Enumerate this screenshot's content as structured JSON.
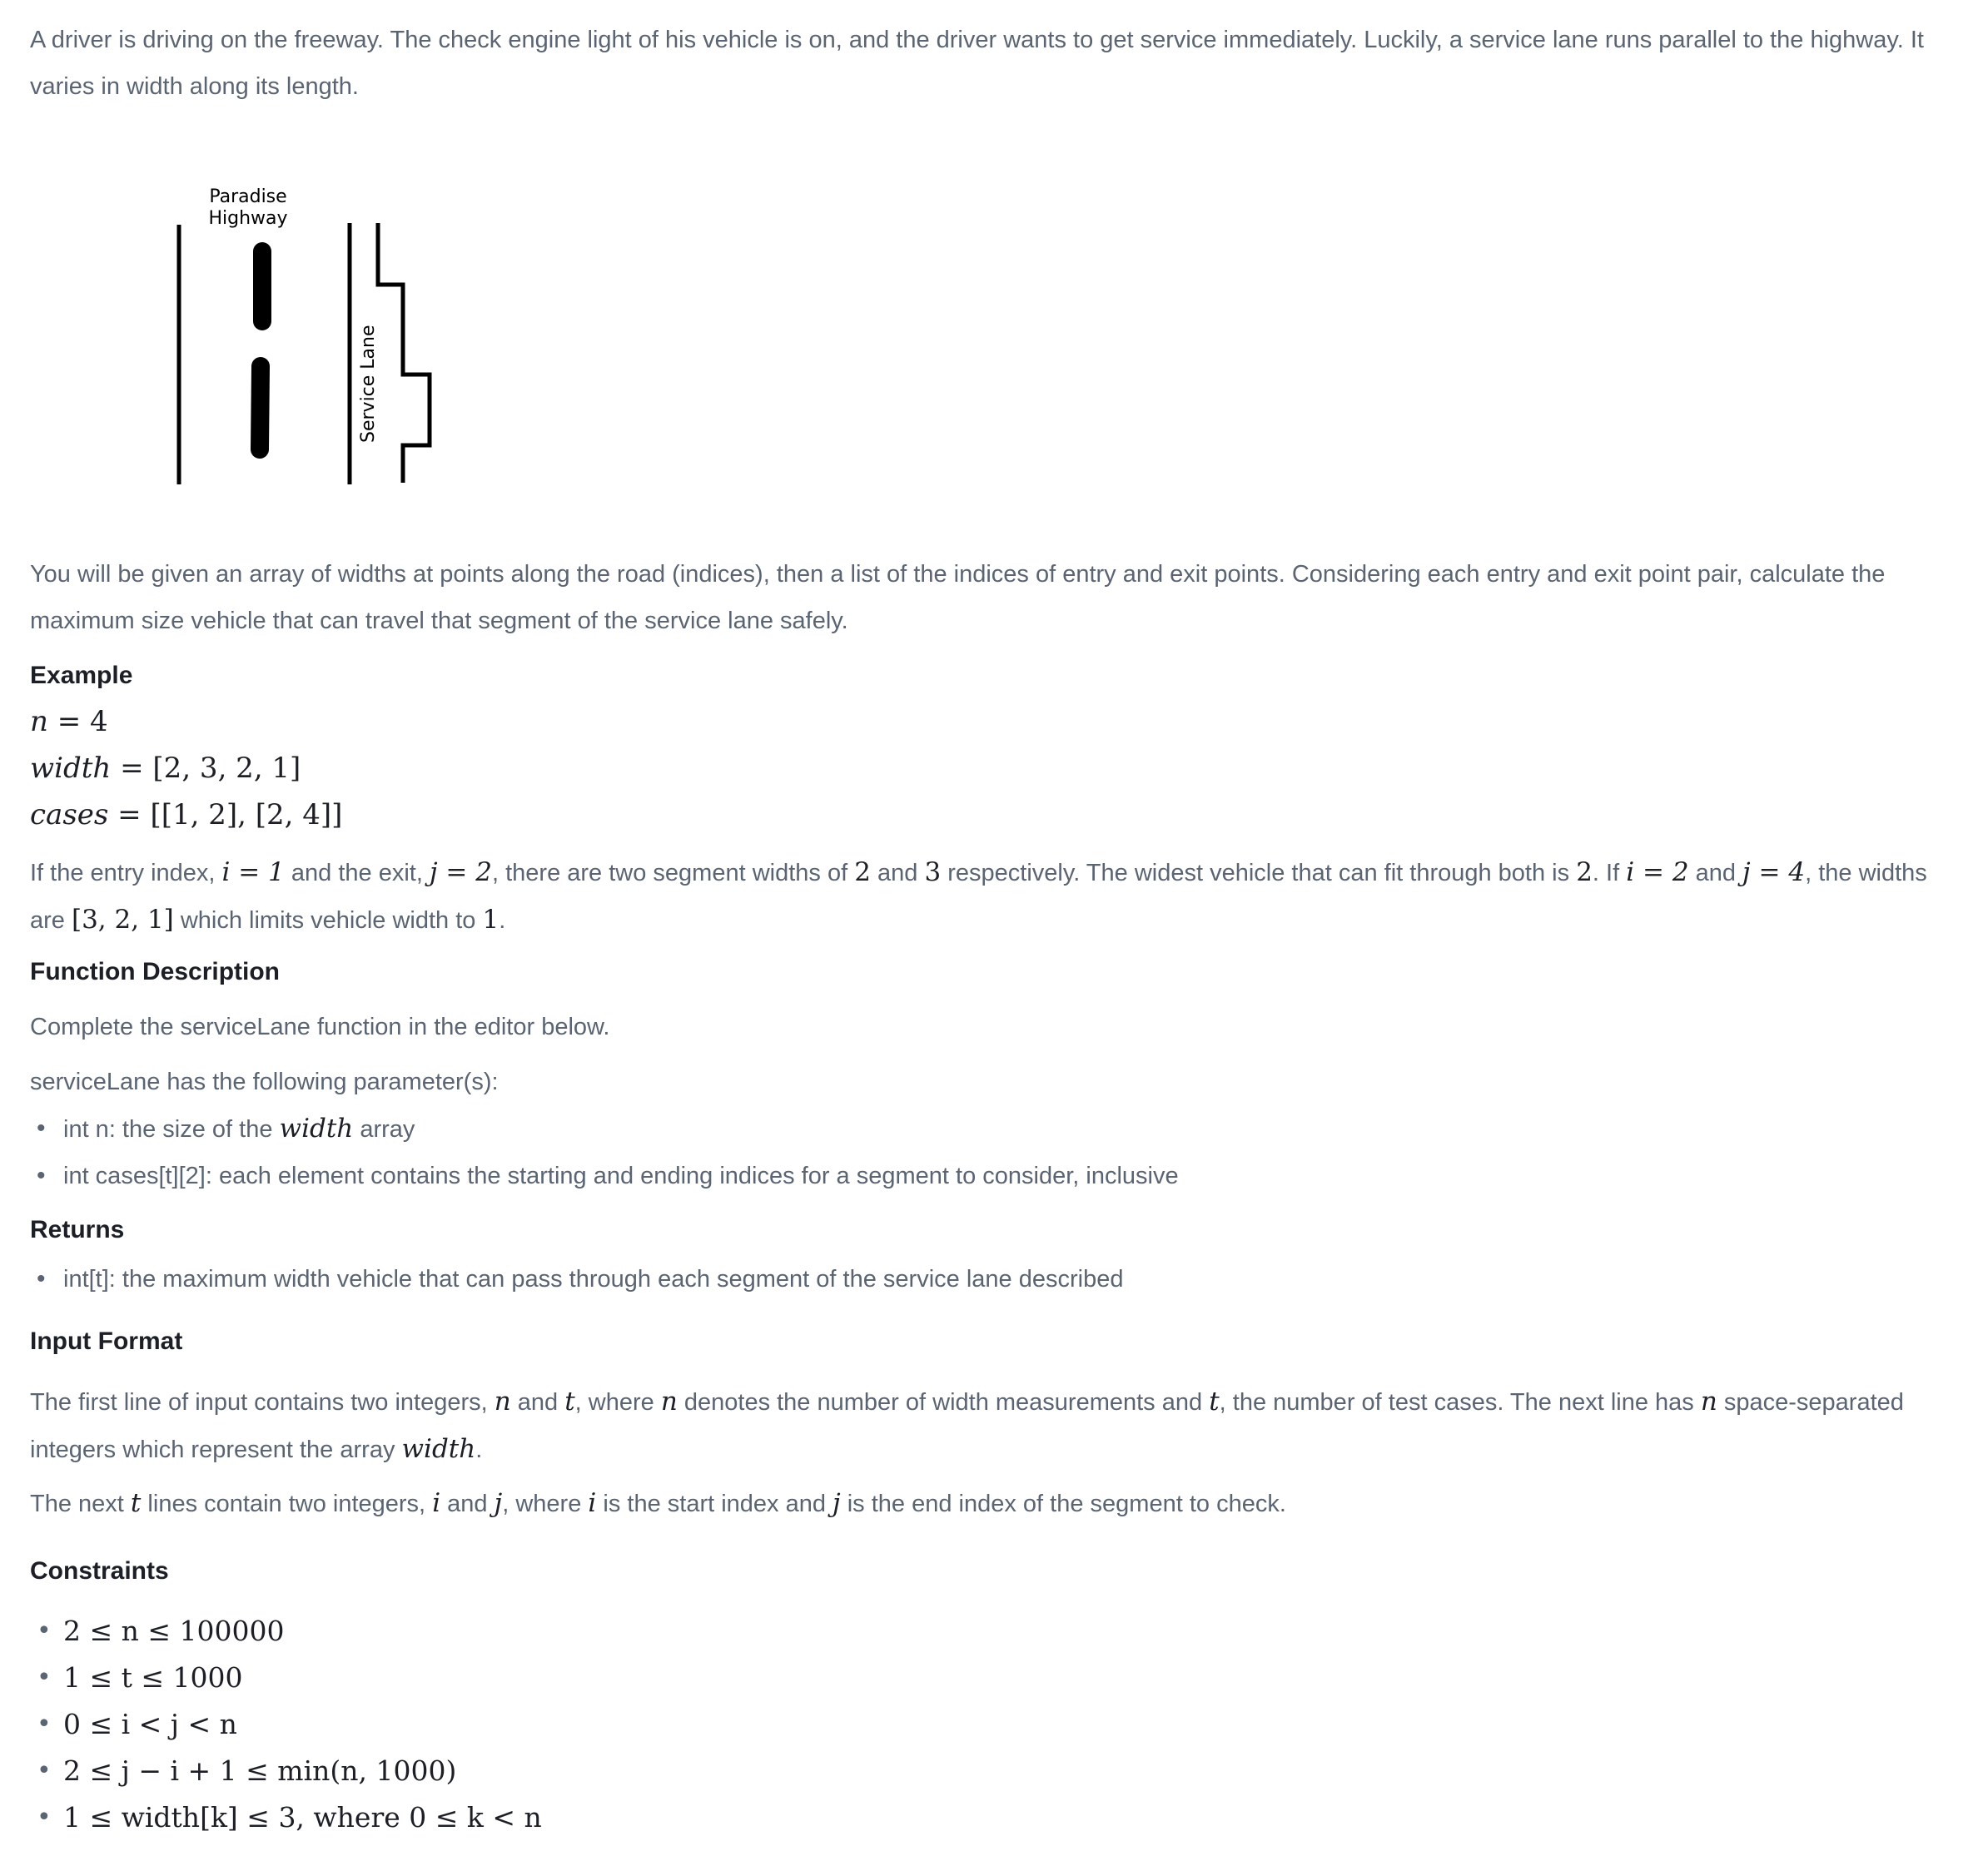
{
  "intro": {
    "line1": "A driver is driving on the freeway. The check engine light of his vehicle is on, and the driver wants to get service immediately. Luckily, a service lane runs parallel to the highway. It",
    "line2": "varies in width along its length."
  },
  "figure": {
    "highway_label_1": "Paradise",
    "highway_label_2": "Highway",
    "lane_label": "Service Lane"
  },
  "desc": {
    "line1": "You will be given an array of widths at points along the road (indices), then a list of the indices of entry and exit points. Considering each entry and exit point pair, calculate the",
    "line2": "maximum size vehicle that can travel that segment of the service lane safely."
  },
  "example": {
    "heading": "Example",
    "n_var": "n",
    "n_val": "4",
    "width_var": "width",
    "width_val": "[2, 3, 2, 1]",
    "cases_var": "cases",
    "cases_val": "[[1, 2], [2, 4]]",
    "explain": {
      "t1": "If the entry index, ",
      "m1": "i = 1",
      "t2": " and the exit, ",
      "m2": "j = 2",
      "t3": ", there are two segment widths of ",
      "m3": "2",
      "t4": " and ",
      "m4": "3",
      "t5": " respectively. The widest vehicle that can fit through both is ",
      "m5": "2",
      "t6": ". If ",
      "m6": "i = 2",
      "t7": " and ",
      "m7": "j = 4",
      "t8": ", the widths",
      "t9": "are ",
      "m8": "[3, 2, 1]",
      "t10": " which limits vehicle width to ",
      "m9": "1",
      "t11": "."
    }
  },
  "function_desc": {
    "heading": "Function Description",
    "line1": "Complete the serviceLane function in the editor below.",
    "line2": "serviceLane has the following parameter(s):",
    "param1_a": "int n: the size of the ",
    "param1_m": "width",
    "param1_b": " array",
    "param2": "int cases[t][2]: each element contains the starting and ending indices for a segment to consider, inclusive"
  },
  "returns": {
    "heading": "Returns",
    "item": "int[t]: the maximum width vehicle that can pass through each segment of the service lane described"
  },
  "input_format": {
    "heading": "Input Format",
    "p1_a": "The first line of input contains two integers, ",
    "p1_m1": "n",
    "p1_b": " and ",
    "p1_m2": "t",
    "p1_c": ", where ",
    "p1_m3": "n",
    "p1_d": " denotes the number of width measurements and ",
    "p1_m4": "t",
    "p1_e": ", the number of test cases. The next line has ",
    "p1_m5": "n",
    "p1_f": " space-separated",
    "p1_g": "integers which represent the array ",
    "p1_m6": "width",
    "p1_h": ".",
    "p2_a": "The next ",
    "p2_m1": "t",
    "p2_b": " lines contain two integers, ",
    "p2_m2": "i",
    "p2_c": " and ",
    "p2_m3": "j",
    "p2_d": ", where ",
    "p2_m4": "i",
    "p2_e": " is the start index and ",
    "p2_m5": "j",
    "p2_f": " is the end index of the segment to check."
  },
  "constraints": {
    "heading": "Constraints",
    "items": [
      "2 ≤ n ≤ 100000",
      "1 ≤ t ≤ 1000",
      "0 ≤ i < j < n",
      "2 ≤ j − i + 1 ≤ min(n, 1000)",
      "1 ≤ width[k] ≤ 3, where 0 ≤ k < n"
    ]
  }
}
